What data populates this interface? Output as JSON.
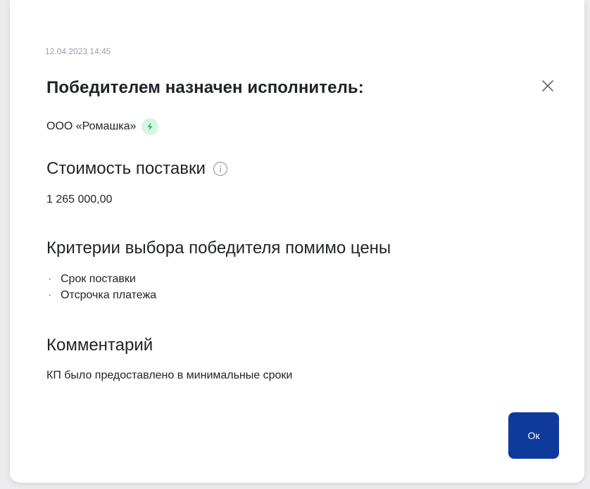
{
  "dialog": {
    "timestamp": "12.04.2023 14:45",
    "title": "Победителем назначен исполнитель:",
    "winner": {
      "name": "ООО «Ромашка»",
      "badge_icon": "lightning-icon",
      "badge_color": "#2fbf5b"
    },
    "cost": {
      "heading": "Стоимость поставки",
      "info_icon": "info-icon",
      "value": "1 265 000,00"
    },
    "criteria": {
      "heading": "Критерии выбора победителя помимо цены",
      "items": [
        "Срок поставки",
        "Отсрочка платежа"
      ]
    },
    "comment": {
      "heading": "Комментарий",
      "text": "КП было предоставлено в минимальные сроки"
    },
    "ok_label": "Ок",
    "close_icon": "close-icon",
    "accent_color": "#0e3a9c"
  }
}
